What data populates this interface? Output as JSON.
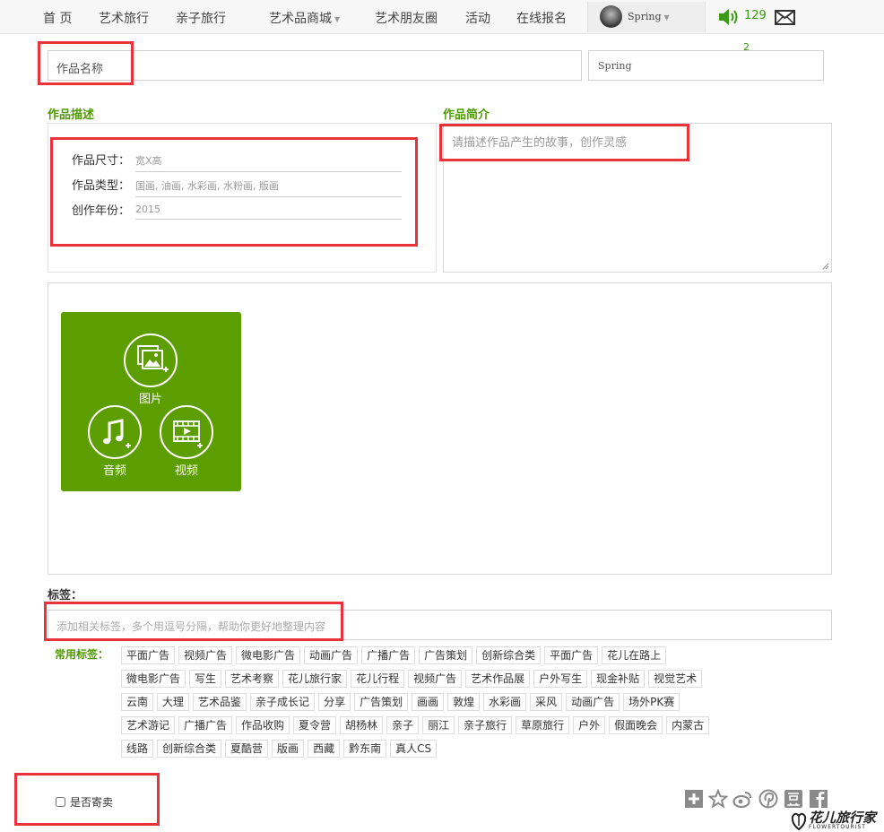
{
  "nav": {
    "items": [
      {
        "label": "首 页"
      },
      {
        "label": "艺术旅行"
      },
      {
        "label": "亲子旅行"
      },
      {
        "label": "艺术品商城"
      },
      {
        "label": "艺术朋友圈"
      },
      {
        "label": "活动"
      },
      {
        "label": "在线报名"
      }
    ],
    "dropdown_arrow": "▼",
    "user_name": "Spring",
    "sound_count": "129",
    "notification_count": "2",
    "icons": [
      "avatar",
      "speaker-icon",
      "mail-icon"
    ]
  },
  "form": {
    "title_placeholder": "作品名称",
    "author_value": "Spring",
    "description_heading": "作品描述",
    "intro_heading": "作品简介",
    "description_rows": [
      {
        "label": "作品尺寸：",
        "placeholder": "宽X高"
      },
      {
        "label": "作品类型：",
        "placeholder": "国画, 油画, 水彩画, 水粉画, 版画"
      },
      {
        "label": "创作年份：",
        "placeholder": "2015"
      }
    ],
    "intro_placeholder": "请描述作品产生的故事，创作灵感"
  },
  "media": {
    "tile_color": "#5c9d00",
    "buttons": [
      {
        "label": "图片",
        "icon": "image-plus-icon"
      },
      {
        "label": "音频",
        "icon": "music-plus-icon"
      },
      {
        "label": "视频",
        "icon": "video-plus-icon"
      }
    ]
  },
  "tags": {
    "heading": "标签：",
    "input_placeholder": "添加相关标签，多个用逗号分隔，帮助你更好地整理内容",
    "common_label": "常用标签：",
    "rows": [
      [
        "平面广告",
        "视频广告",
        "微电影广告",
        "动画广告",
        "广播广告",
        "广告策划",
        "创新综合类",
        "平面广告",
        "花儿在路上"
      ],
      [
        "微电影广告",
        "写生",
        "艺术考察",
        "花儿旅行家",
        "花儿行程",
        "视频广告",
        "艺术作品展",
        "户外写生",
        "现金补贴",
        "视觉艺术"
      ],
      [
        "云南",
        "大理",
        "艺术品鉴",
        "亲子成长记",
        "分享",
        "广告策划",
        "画画",
        "敦煌",
        "水彩画",
        "采风",
        "动画广告",
        "场外PK赛"
      ],
      [
        "艺术游记",
        "广播广告",
        "作品收购",
        "夏令营",
        "胡杨林",
        "亲子",
        "丽江",
        "亲子旅行",
        "草原旅行",
        "户外",
        "假面晚会",
        "内蒙古"
      ],
      [
        "线路",
        "创新综合类",
        "夏酷营",
        "版画",
        "西藏",
        "黔东南",
        "真人CS"
      ]
    ]
  },
  "consign_label": "是否寄卖",
  "share_icons": [
    "plus-share-icon",
    "star-icon",
    "weibo-icon",
    "pinterest-icon",
    "douban-icon",
    "facebook-icon"
  ],
  "logo": {
    "text": "花儿旅行家",
    "sub": "FLOWERTOURIST"
  },
  "accent_color": "#4f9a00",
  "annotation_color": "#e8323c"
}
